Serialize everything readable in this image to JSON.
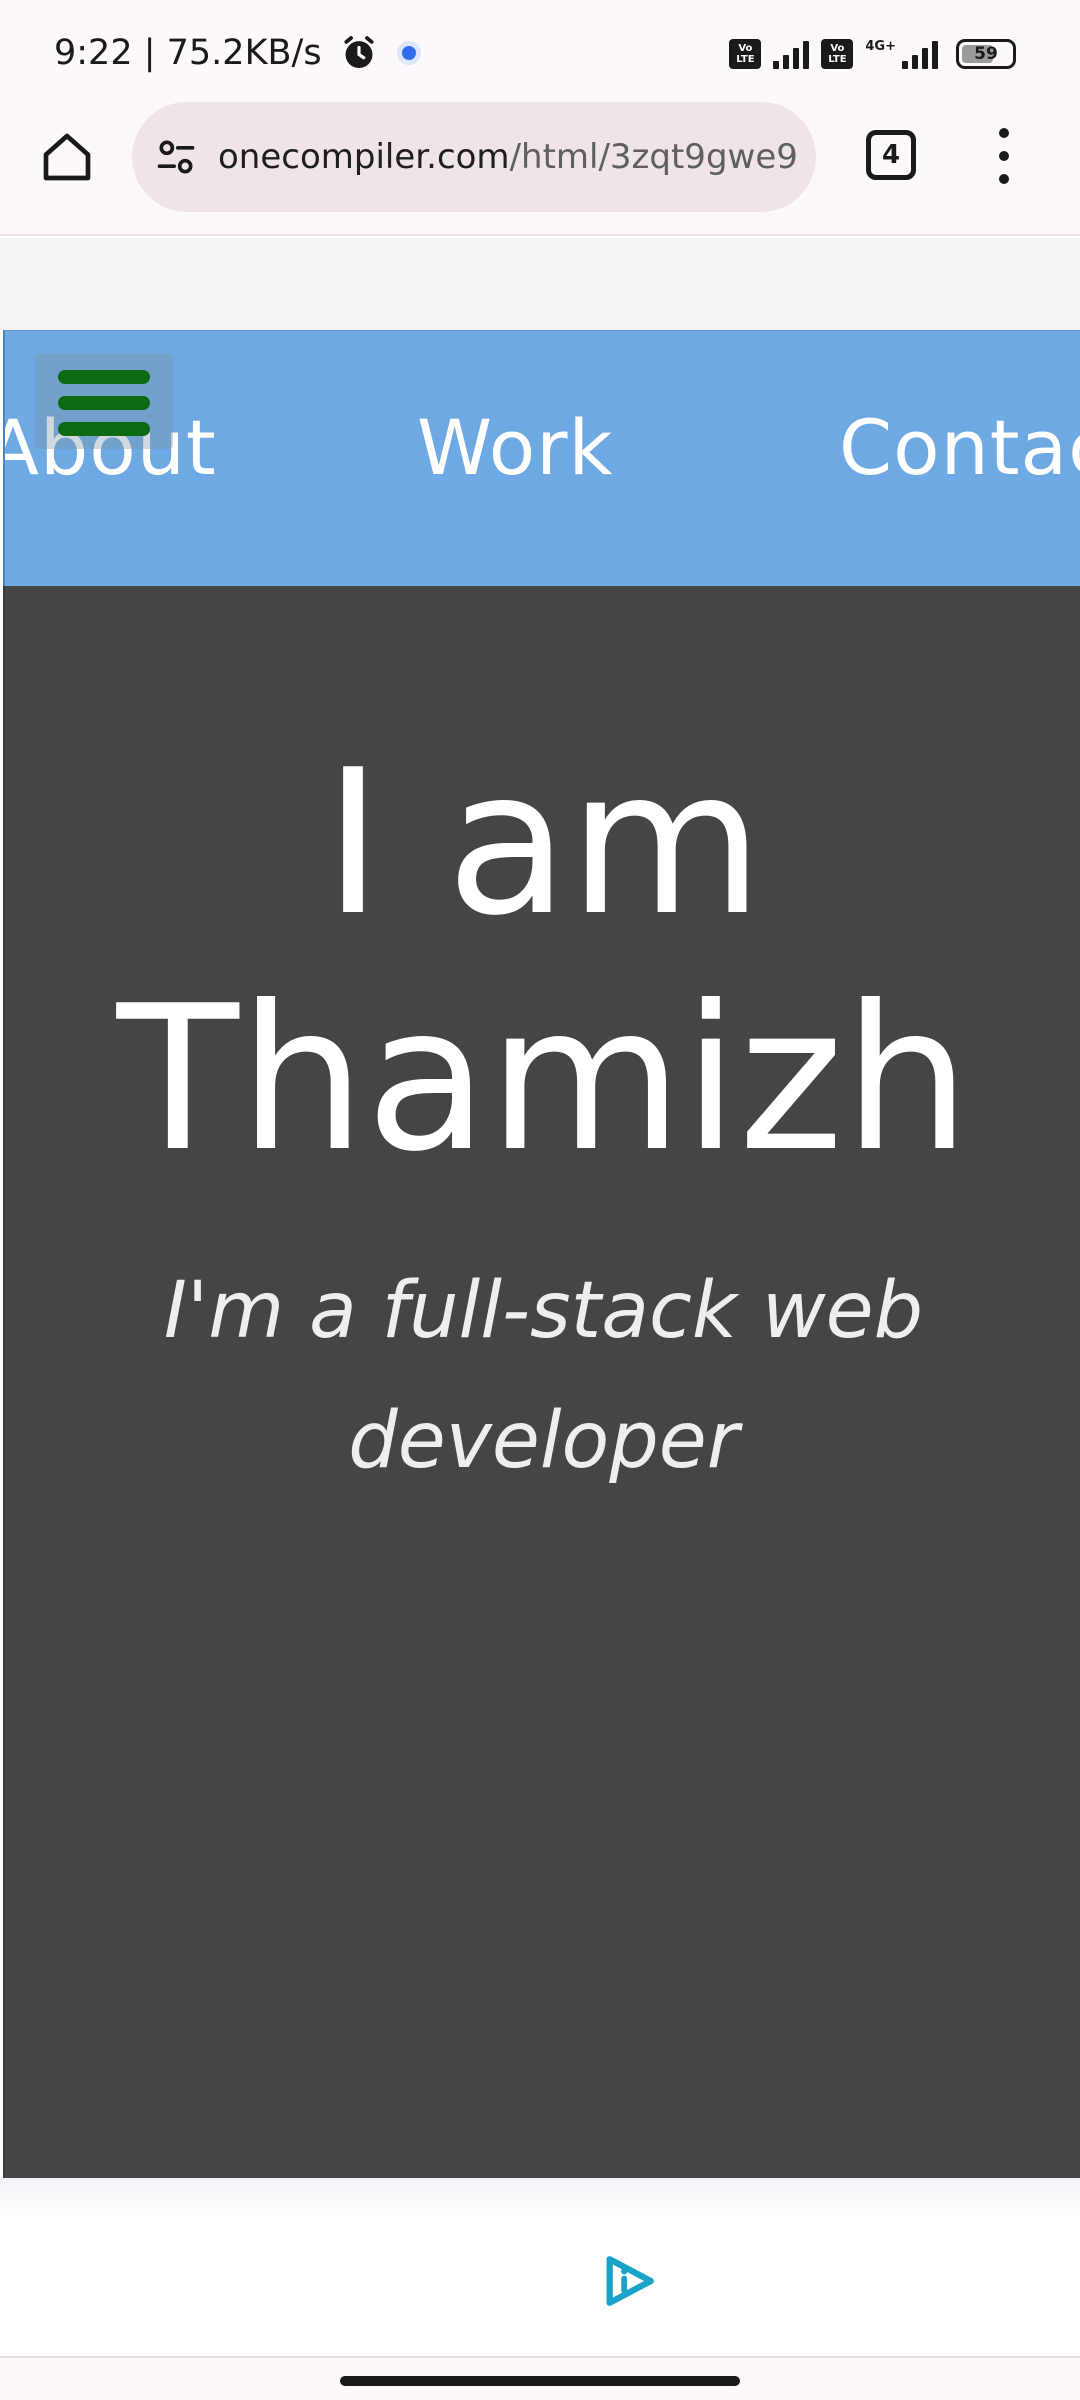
{
  "status_bar": {
    "time_speed": "9:22 | 75.2KB/s",
    "sim1_tag": "Vo LTE",
    "sim2_tag": "Vo LTE",
    "network_type": "4G+",
    "battery": "59",
    "icons": [
      "alarm-icon",
      "notification-dot-icon",
      "signal-icon",
      "battery-icon"
    ]
  },
  "browser": {
    "url_host": "onecompiler.com",
    "url_path": "/html/3zqt9gwe9",
    "tab_count": "4",
    "icons": [
      "home-icon",
      "site-settings-icon",
      "tab-switcher-icon",
      "more-menu-icon"
    ]
  },
  "site": {
    "nav": {
      "links": [
        "About",
        "Work",
        "Contac"
      ],
      "bar_color": "#6fa9e4",
      "hamburger_color": "#0c6a14"
    },
    "hero": {
      "title_line1": "I am",
      "title_line2": "Thamizh",
      "subtitle_line1": "I'm a full-stack web",
      "subtitle_line2": "developer",
      "background": "#454545"
    },
    "floating_icon": "run-play-icon"
  }
}
